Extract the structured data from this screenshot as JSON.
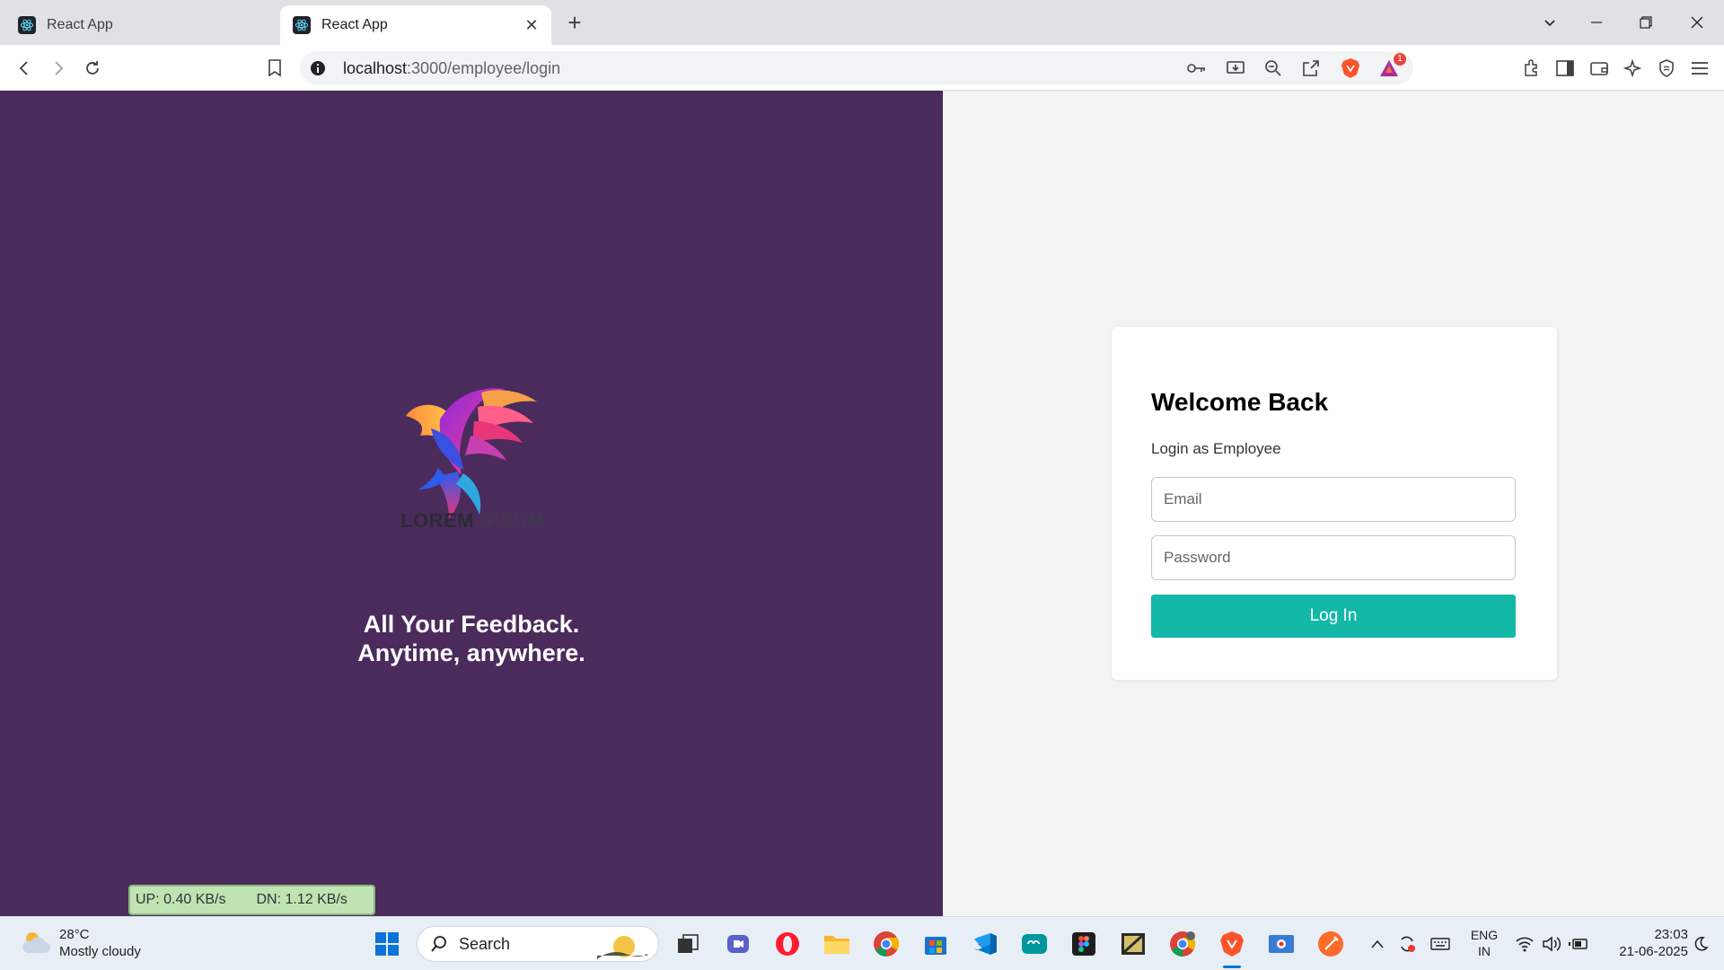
{
  "browser": {
    "tabs": [
      {
        "title": "React App",
        "active": false
      },
      {
        "title": "React App",
        "active": true
      }
    ],
    "url_host": "localhost",
    "url_path": ":3000/employee/login",
    "shields_badge": "1"
  },
  "page": {
    "brand": {
      "word_bold": "LOREM",
      "word_light": " IPSUM"
    },
    "tagline_line1": "All Your Feedback.",
    "tagline_line2": "Anytime, anywhere.",
    "login": {
      "title": "Welcome Back",
      "subtitle": "Login as Employee",
      "email_placeholder": "Email",
      "password_placeholder": "Password",
      "submit_label": "Log In"
    },
    "colors": {
      "left_bg": "#4a2b5c",
      "accent": "#14b8a6"
    }
  },
  "netspeed": {
    "up": "UP: 0.40 KB/s",
    "down": "DN: 1.12 KB/s"
  },
  "taskbar": {
    "weather_temp": "28°C",
    "weather_desc": "Mostly cloudy",
    "search_label": "Search",
    "lang_line1": "ENG",
    "lang_line2": "IN",
    "time": "23:03",
    "date": "21-06-2025"
  }
}
